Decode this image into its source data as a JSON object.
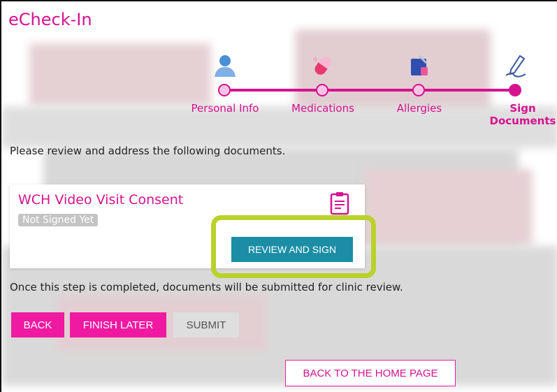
{
  "app": {
    "title": "eCheck-In"
  },
  "stepper": {
    "steps": [
      {
        "label": "Personal Info",
        "icon": "person-icon",
        "active": false
      },
      {
        "label": "Medications",
        "icon": "pill-icon",
        "active": false
      },
      {
        "label": "Allergies",
        "icon": "allergy-icon",
        "active": false
      },
      {
        "label": "Sign Documents",
        "icon": "pen-icon",
        "active": true
      }
    ]
  },
  "instructions": "Please review and address the following documents.",
  "document": {
    "title": "WCH Video Visit Consent",
    "status": "Not Signed Yet",
    "icon": "clipboard-icon",
    "action_label": "REVIEW AND SIGN"
  },
  "note": "Once this step is completed, documents will be submitted for clinic review.",
  "actions": {
    "back": "BACK",
    "finish_later": "FINISH LATER",
    "submit": "SUBMIT",
    "home": "BACK TO THE HOME PAGE"
  },
  "colors": {
    "brand": "#d5128f",
    "button_pink": "#ef1aa1",
    "review_button": "#1b8ea6",
    "highlight": "#b9d22b"
  }
}
